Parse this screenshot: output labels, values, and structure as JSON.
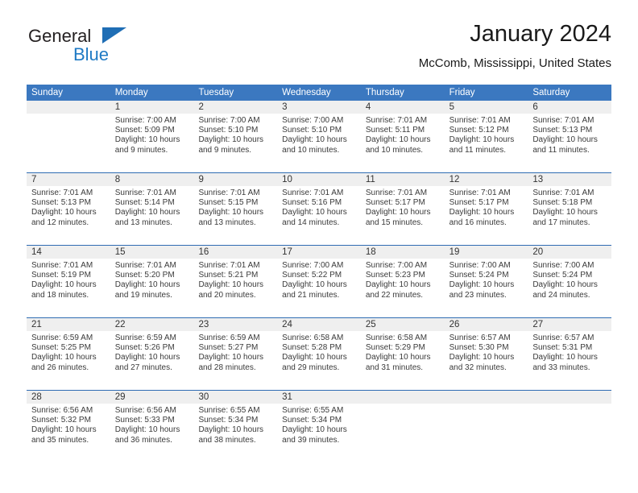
{
  "brand": {
    "name_top": "General",
    "name_bottom": "Blue",
    "color_dark": "#231f20",
    "color_blue": "#1f7ac4"
  },
  "header": {
    "title": "January 2024",
    "subtitle": "McComb, Mississippi, United States"
  },
  "theme": {
    "header_bg": "#3b78c0",
    "header_text": "#ffffff",
    "daynum_band": "#efefef",
    "row_divider": "#2f6cb3"
  },
  "calendar": {
    "weekdays": [
      "Sunday",
      "Monday",
      "Tuesday",
      "Wednesday",
      "Thursday",
      "Friday",
      "Saturday"
    ],
    "weeks": [
      [
        {
          "day": "",
          "sunrise": "",
          "sunset": "",
          "daylight1": "",
          "daylight2": ""
        },
        {
          "day": "1",
          "sunrise": "Sunrise: 7:00 AM",
          "sunset": "Sunset: 5:09 PM",
          "daylight1": "Daylight: 10 hours",
          "daylight2": "and 9 minutes."
        },
        {
          "day": "2",
          "sunrise": "Sunrise: 7:00 AM",
          "sunset": "Sunset: 5:10 PM",
          "daylight1": "Daylight: 10 hours",
          "daylight2": "and 9 minutes."
        },
        {
          "day": "3",
          "sunrise": "Sunrise: 7:00 AM",
          "sunset": "Sunset: 5:10 PM",
          "daylight1": "Daylight: 10 hours",
          "daylight2": "and 10 minutes."
        },
        {
          "day": "4",
          "sunrise": "Sunrise: 7:01 AM",
          "sunset": "Sunset: 5:11 PM",
          "daylight1": "Daylight: 10 hours",
          "daylight2": "and 10 minutes."
        },
        {
          "day": "5",
          "sunrise": "Sunrise: 7:01 AM",
          "sunset": "Sunset: 5:12 PM",
          "daylight1": "Daylight: 10 hours",
          "daylight2": "and 11 minutes."
        },
        {
          "day": "6",
          "sunrise": "Sunrise: 7:01 AM",
          "sunset": "Sunset: 5:13 PM",
          "daylight1": "Daylight: 10 hours",
          "daylight2": "and 11 minutes."
        }
      ],
      [
        {
          "day": "7",
          "sunrise": "Sunrise: 7:01 AM",
          "sunset": "Sunset: 5:13 PM",
          "daylight1": "Daylight: 10 hours",
          "daylight2": "and 12 minutes."
        },
        {
          "day": "8",
          "sunrise": "Sunrise: 7:01 AM",
          "sunset": "Sunset: 5:14 PM",
          "daylight1": "Daylight: 10 hours",
          "daylight2": "and 13 minutes."
        },
        {
          "day": "9",
          "sunrise": "Sunrise: 7:01 AM",
          "sunset": "Sunset: 5:15 PM",
          "daylight1": "Daylight: 10 hours",
          "daylight2": "and 13 minutes."
        },
        {
          "day": "10",
          "sunrise": "Sunrise: 7:01 AM",
          "sunset": "Sunset: 5:16 PM",
          "daylight1": "Daylight: 10 hours",
          "daylight2": "and 14 minutes."
        },
        {
          "day": "11",
          "sunrise": "Sunrise: 7:01 AM",
          "sunset": "Sunset: 5:17 PM",
          "daylight1": "Daylight: 10 hours",
          "daylight2": "and 15 minutes."
        },
        {
          "day": "12",
          "sunrise": "Sunrise: 7:01 AM",
          "sunset": "Sunset: 5:17 PM",
          "daylight1": "Daylight: 10 hours",
          "daylight2": "and 16 minutes."
        },
        {
          "day": "13",
          "sunrise": "Sunrise: 7:01 AM",
          "sunset": "Sunset: 5:18 PM",
          "daylight1": "Daylight: 10 hours",
          "daylight2": "and 17 minutes."
        }
      ],
      [
        {
          "day": "14",
          "sunrise": "Sunrise: 7:01 AM",
          "sunset": "Sunset: 5:19 PM",
          "daylight1": "Daylight: 10 hours",
          "daylight2": "and 18 minutes."
        },
        {
          "day": "15",
          "sunrise": "Sunrise: 7:01 AM",
          "sunset": "Sunset: 5:20 PM",
          "daylight1": "Daylight: 10 hours",
          "daylight2": "and 19 minutes."
        },
        {
          "day": "16",
          "sunrise": "Sunrise: 7:01 AM",
          "sunset": "Sunset: 5:21 PM",
          "daylight1": "Daylight: 10 hours",
          "daylight2": "and 20 minutes."
        },
        {
          "day": "17",
          "sunrise": "Sunrise: 7:00 AM",
          "sunset": "Sunset: 5:22 PM",
          "daylight1": "Daylight: 10 hours",
          "daylight2": "and 21 minutes."
        },
        {
          "day": "18",
          "sunrise": "Sunrise: 7:00 AM",
          "sunset": "Sunset: 5:23 PM",
          "daylight1": "Daylight: 10 hours",
          "daylight2": "and 22 minutes."
        },
        {
          "day": "19",
          "sunrise": "Sunrise: 7:00 AM",
          "sunset": "Sunset: 5:24 PM",
          "daylight1": "Daylight: 10 hours",
          "daylight2": "and 23 minutes."
        },
        {
          "day": "20",
          "sunrise": "Sunrise: 7:00 AM",
          "sunset": "Sunset: 5:24 PM",
          "daylight1": "Daylight: 10 hours",
          "daylight2": "and 24 minutes."
        }
      ],
      [
        {
          "day": "21",
          "sunrise": "Sunrise: 6:59 AM",
          "sunset": "Sunset: 5:25 PM",
          "daylight1": "Daylight: 10 hours",
          "daylight2": "and 26 minutes."
        },
        {
          "day": "22",
          "sunrise": "Sunrise: 6:59 AM",
          "sunset": "Sunset: 5:26 PM",
          "daylight1": "Daylight: 10 hours",
          "daylight2": "and 27 minutes."
        },
        {
          "day": "23",
          "sunrise": "Sunrise: 6:59 AM",
          "sunset": "Sunset: 5:27 PM",
          "daylight1": "Daylight: 10 hours",
          "daylight2": "and 28 minutes."
        },
        {
          "day": "24",
          "sunrise": "Sunrise: 6:58 AM",
          "sunset": "Sunset: 5:28 PM",
          "daylight1": "Daylight: 10 hours",
          "daylight2": "and 29 minutes."
        },
        {
          "day": "25",
          "sunrise": "Sunrise: 6:58 AM",
          "sunset": "Sunset: 5:29 PM",
          "daylight1": "Daylight: 10 hours",
          "daylight2": "and 31 minutes."
        },
        {
          "day": "26",
          "sunrise": "Sunrise: 6:57 AM",
          "sunset": "Sunset: 5:30 PM",
          "daylight1": "Daylight: 10 hours",
          "daylight2": "and 32 minutes."
        },
        {
          "day": "27",
          "sunrise": "Sunrise: 6:57 AM",
          "sunset": "Sunset: 5:31 PM",
          "daylight1": "Daylight: 10 hours",
          "daylight2": "and 33 minutes."
        }
      ],
      [
        {
          "day": "28",
          "sunrise": "Sunrise: 6:56 AM",
          "sunset": "Sunset: 5:32 PM",
          "daylight1": "Daylight: 10 hours",
          "daylight2": "and 35 minutes."
        },
        {
          "day": "29",
          "sunrise": "Sunrise: 6:56 AM",
          "sunset": "Sunset: 5:33 PM",
          "daylight1": "Daylight: 10 hours",
          "daylight2": "and 36 minutes."
        },
        {
          "day": "30",
          "sunrise": "Sunrise: 6:55 AM",
          "sunset": "Sunset: 5:34 PM",
          "daylight1": "Daylight: 10 hours",
          "daylight2": "and 38 minutes."
        },
        {
          "day": "31",
          "sunrise": "Sunrise: 6:55 AM",
          "sunset": "Sunset: 5:34 PM",
          "daylight1": "Daylight: 10 hours",
          "daylight2": "and 39 minutes."
        },
        {
          "day": "",
          "sunrise": "",
          "sunset": "",
          "daylight1": "",
          "daylight2": ""
        },
        {
          "day": "",
          "sunrise": "",
          "sunset": "",
          "daylight1": "",
          "daylight2": ""
        },
        {
          "day": "",
          "sunrise": "",
          "sunset": "",
          "daylight1": "",
          "daylight2": ""
        }
      ]
    ]
  }
}
